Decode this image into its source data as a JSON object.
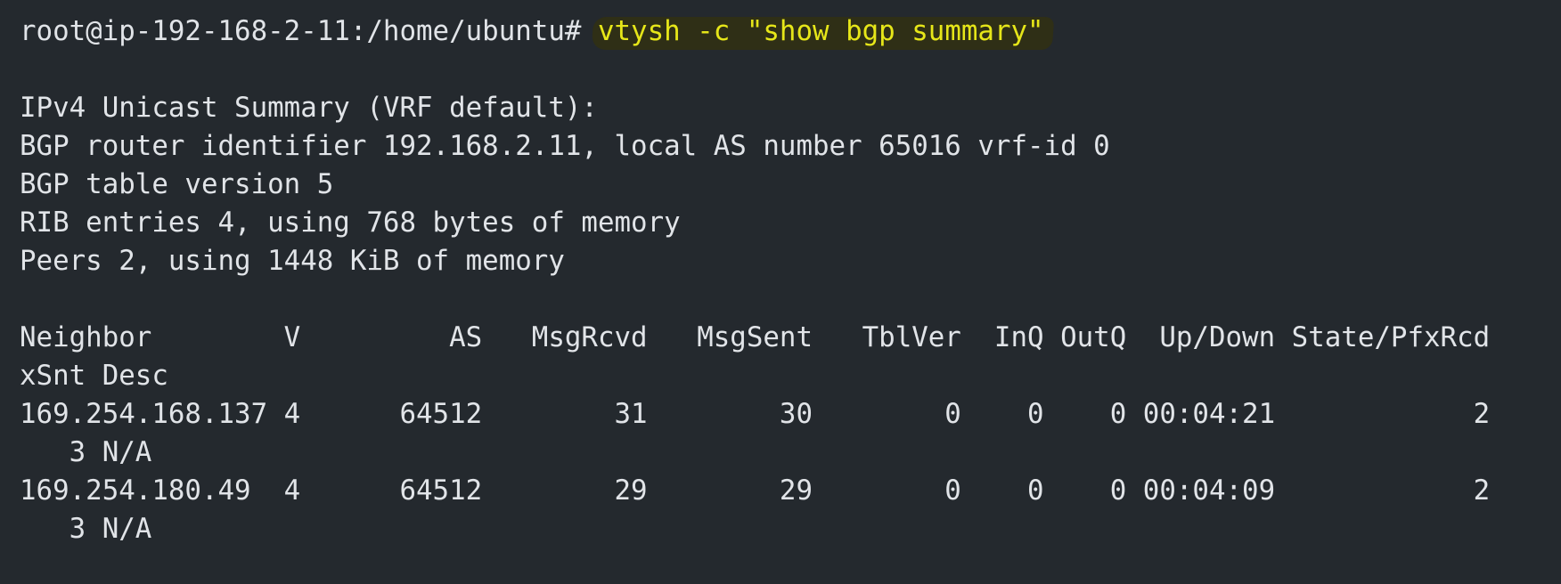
{
  "terminal": {
    "prompt": "root@ip-192-168-2-11:/home/ubuntu# ",
    "command": "vtysh -c \"show bgp summary\"",
    "lines": [
      "",
      "IPv4 Unicast Summary (VRF default):",
      "BGP router identifier 192.168.2.11, local AS number 65016 vrf-id 0",
      "BGP table version 5",
      "RIB entries 4, using 768 bytes of memory",
      "Peers 2, using 1448 KiB of memory",
      "",
      "Neighbor        V         AS   MsgRcvd   MsgSent   TblVer  InQ OutQ  Up/Down State/PfxRcd",
      "xSnt Desc",
      "169.254.168.137 4      64512        31        30        0    0    0 00:04:21            2",
      "   3 N/A",
      "169.254.180.49  4      64512        29        29        0    0    0 00:04:09            2",
      "   3 N/A"
    ]
  },
  "colors": {
    "background": "#24292e",
    "text": "#e1e4e8",
    "command": "#e6e619",
    "highlight": "#2f2f16"
  }
}
